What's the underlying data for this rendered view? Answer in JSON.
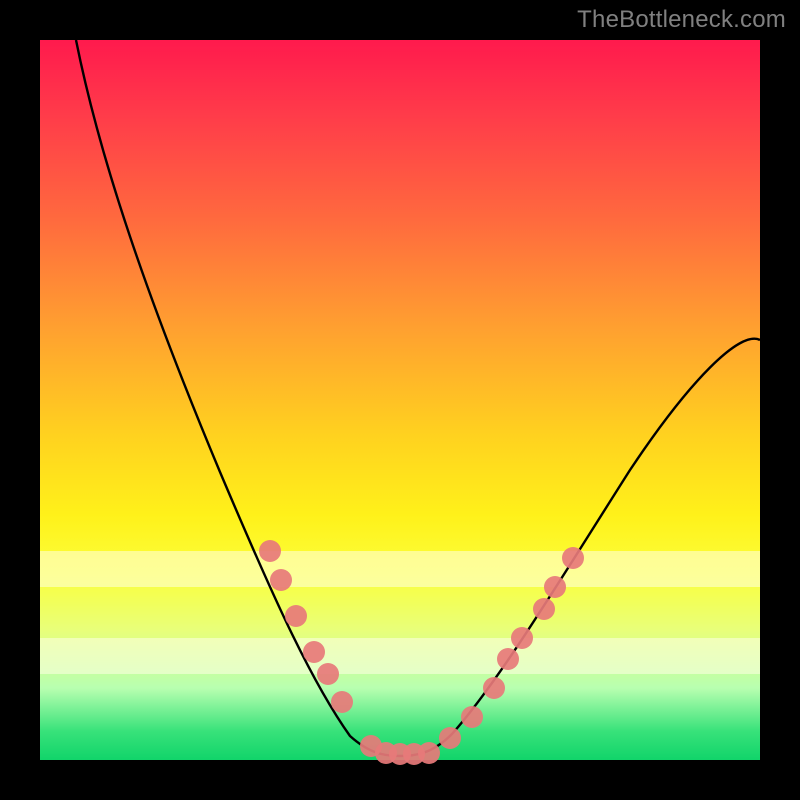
{
  "watermark": "TheBottleneck.com",
  "chart_data": {
    "type": "line",
    "title": "",
    "xlabel": "",
    "ylabel": "",
    "xlim": [
      0,
      100
    ],
    "ylim": [
      0,
      100
    ],
    "grid": false,
    "legend": false,
    "series": [
      {
        "name": "bottleneck-curve",
        "x": [
          5,
          10,
          15,
          20,
          25,
          30,
          35,
          38,
          41,
          44,
          47,
          50,
          53,
          56,
          60,
          65,
          70,
          75,
          80,
          85,
          90,
          95,
          100
        ],
        "y": [
          100,
          88,
          74,
          60,
          46,
          33,
          22,
          16,
          10,
          5,
          2,
          0.5,
          0.5,
          2,
          5,
          11,
          18,
          26,
          33,
          40,
          47,
          53,
          58
        ]
      }
    ],
    "markers": [
      {
        "series": "bottleneck-curve",
        "x": 32,
        "y": 29
      },
      {
        "series": "bottleneck-curve",
        "x": 33.5,
        "y": 25
      },
      {
        "series": "bottleneck-curve",
        "x": 35.5,
        "y": 20
      },
      {
        "series": "bottleneck-curve",
        "x": 38,
        "y": 15
      },
      {
        "series": "bottleneck-curve",
        "x": 40,
        "y": 12
      },
      {
        "series": "bottleneck-curve",
        "x": 42,
        "y": 8
      },
      {
        "series": "bottleneck-curve",
        "x": 46,
        "y": 2
      },
      {
        "series": "bottleneck-curve",
        "x": 48,
        "y": 1
      },
      {
        "series": "bottleneck-curve",
        "x": 50,
        "y": 0.8
      },
      {
        "series": "bottleneck-curve",
        "x": 52,
        "y": 0.8
      },
      {
        "series": "bottleneck-curve",
        "x": 54,
        "y": 1
      },
      {
        "series": "bottleneck-curve",
        "x": 57,
        "y": 3
      },
      {
        "series": "bottleneck-curve",
        "x": 60,
        "y": 6
      },
      {
        "series": "bottleneck-curve",
        "x": 63,
        "y": 10
      },
      {
        "series": "bottleneck-curve",
        "x": 65,
        "y": 14
      },
      {
        "series": "bottleneck-curve",
        "x": 67,
        "y": 17
      },
      {
        "series": "bottleneck-curve",
        "x": 70,
        "y": 21
      },
      {
        "series": "bottleneck-curve",
        "x": 71.5,
        "y": 24
      },
      {
        "series": "bottleneck-curve",
        "x": 74,
        "y": 28
      }
    ],
    "bands": [
      {
        "name": "pale-band-upper",
        "y0": 24,
        "y1": 29,
        "alpha": 0.55
      },
      {
        "name": "pale-band-lower",
        "y0": 12,
        "y1": 17,
        "alpha": 0.55
      }
    ],
    "colors": {
      "curve": "#000000",
      "marker": "#e77a7a",
      "gradient_top": "#ff1a4d",
      "gradient_bottom": "#11d46a"
    }
  }
}
